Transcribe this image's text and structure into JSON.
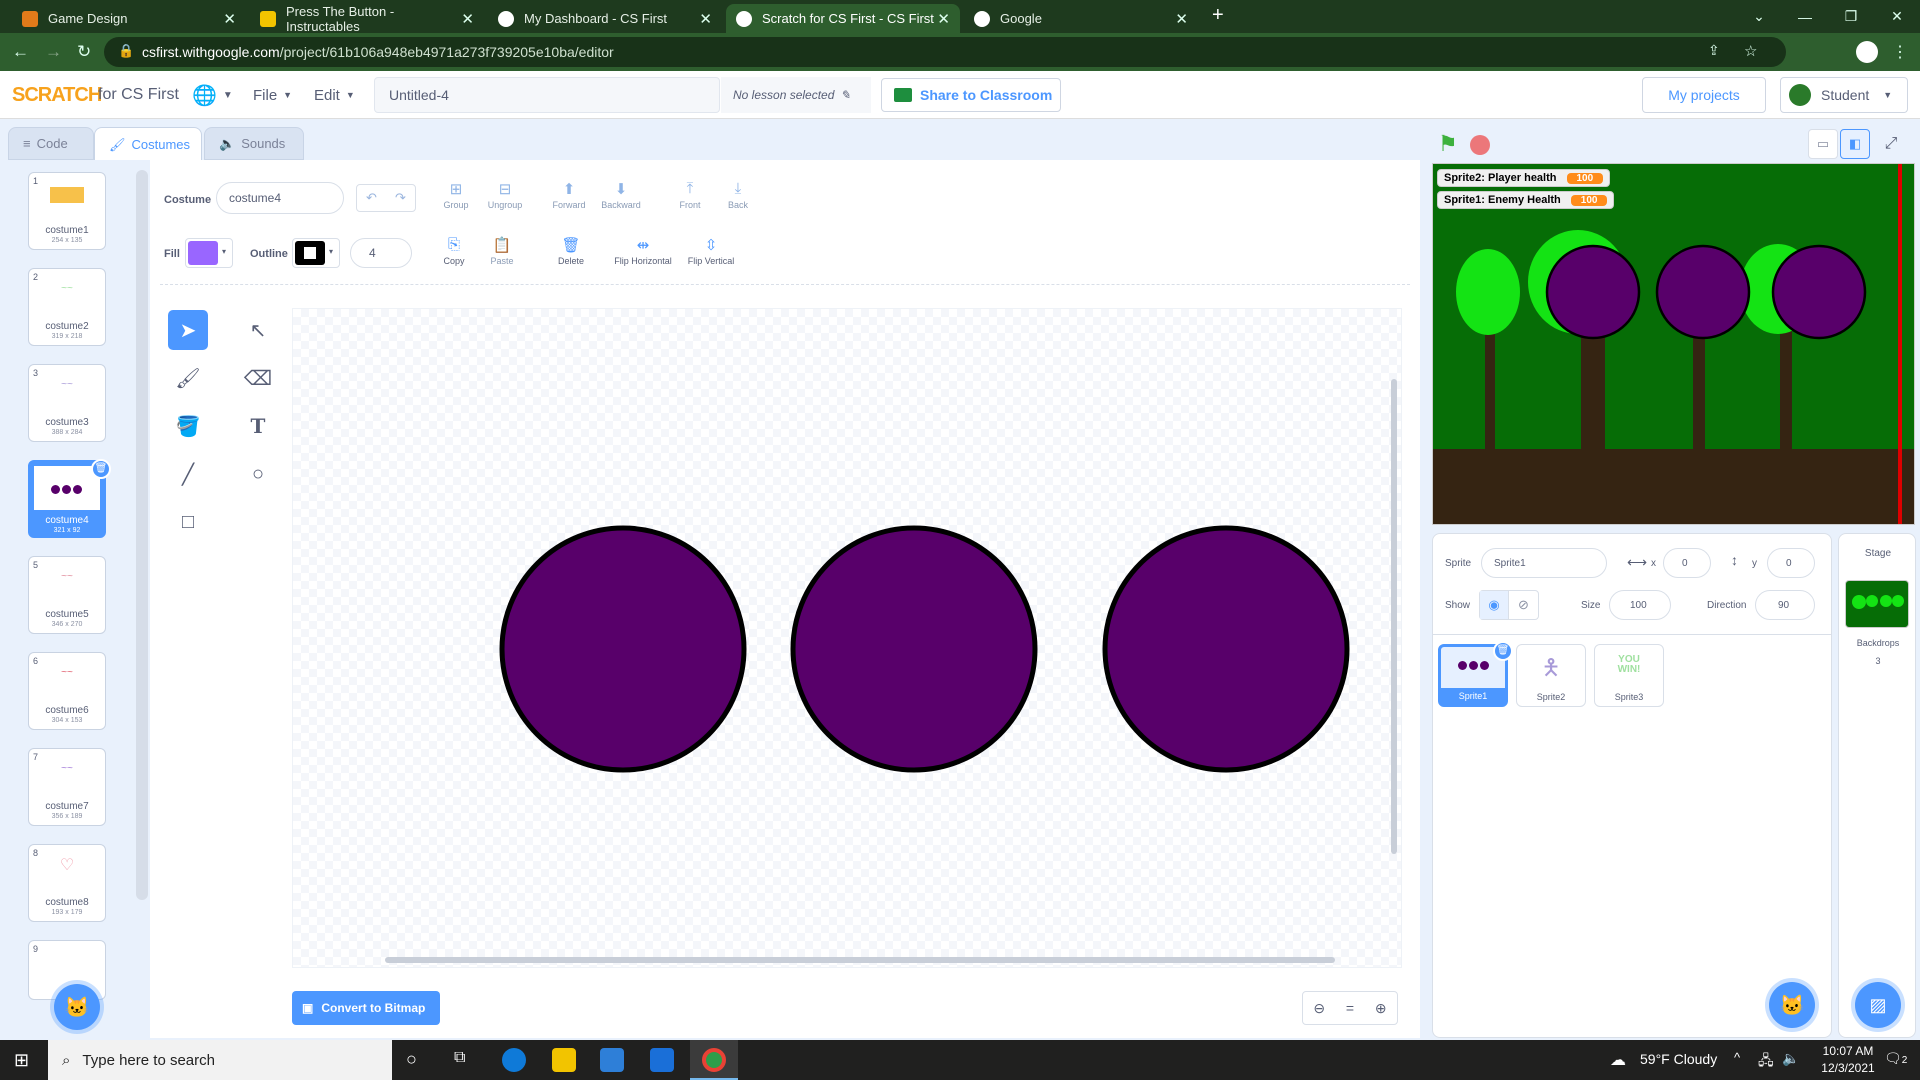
{
  "browser": {
    "tabs": [
      {
        "title": "Game Design"
      },
      {
        "title": "Press The Button - Instructables"
      },
      {
        "title": "My Dashboard - CS First"
      },
      {
        "title": "Scratch for CS First - CS First"
      },
      {
        "title": "Google"
      }
    ],
    "url_host": "csfirst.withgoogle.com",
    "url_path": "/project/61b106a948eb4971a273f739205e10ba/editor"
  },
  "menubar": {
    "logo": "SCRATCH",
    "brand": "for CS First",
    "file": "File",
    "edit": "Edit",
    "project_title": "Untitled-4",
    "lesson": "No lesson selected",
    "share": "Share to Classroom",
    "my_projects": "My projects",
    "user": "Student"
  },
  "tabs": {
    "code": "Code",
    "costumes": "Costumes",
    "sounds": "Sounds"
  },
  "costumes": [
    {
      "num": "1",
      "name": "costume1",
      "size": "254 x 135"
    },
    {
      "num": "2",
      "name": "costume2",
      "size": "319 x 218"
    },
    {
      "num": "3",
      "name": "costume3",
      "size": "388 x 284"
    },
    {
      "num": "4",
      "name": "costume4",
      "size": "321 x 92"
    },
    {
      "num": "5",
      "name": "costume5",
      "size": "346 x 270"
    },
    {
      "num": "6",
      "name": "costume6",
      "size": "304 x 153"
    },
    {
      "num": "7",
      "name": "costume7",
      "size": "356 x 189"
    },
    {
      "num": "8",
      "name": "costume8",
      "size": "193 x 179"
    },
    {
      "num": "9",
      "name": "",
      "size": ""
    }
  ],
  "editor": {
    "costume_label": "Costume",
    "costume_name": "costume4",
    "fill_label": "Fill",
    "outline_label": "Outline",
    "outline_width": "4",
    "fill_color": "#9966ff",
    "buttons": {
      "group": "Group",
      "ungroup": "Ungroup",
      "forward": "Forward",
      "backward": "Backward",
      "front": "Front",
      "back": "Back",
      "copy": "Copy",
      "paste": "Paste",
      "delete": "Delete",
      "flip_h": "Flip Horizontal",
      "flip_v": "Flip Vertical"
    },
    "convert": "Convert to Bitmap",
    "shape_color": "#58006a"
  },
  "stage": {
    "monitors": [
      {
        "label": "Sprite2: Player health",
        "value": "100"
      },
      {
        "label": "Sprite1: Enemy Health",
        "value": "100"
      }
    ]
  },
  "sprite_info": {
    "sprite_label": "Sprite",
    "sprite_name": "Sprite1",
    "x_label": "x",
    "x": "0",
    "y_label": "y",
    "y": "0",
    "show_label": "Show",
    "size_label": "Size",
    "size": "100",
    "direction_label": "Direction",
    "direction": "90"
  },
  "sprites": [
    {
      "name": "Sprite1"
    },
    {
      "name": "Sprite2"
    },
    {
      "name": "Sprite3"
    }
  ],
  "stage_pane": {
    "title": "Stage",
    "backdrops_label": "Backdrops",
    "backdrops_count": "3"
  },
  "taskbar": {
    "search_placeholder": "Type here to search",
    "weather": "59°F  Cloudy",
    "time": "10:07 AM",
    "date": "12/3/2021",
    "notif_count": "2"
  }
}
